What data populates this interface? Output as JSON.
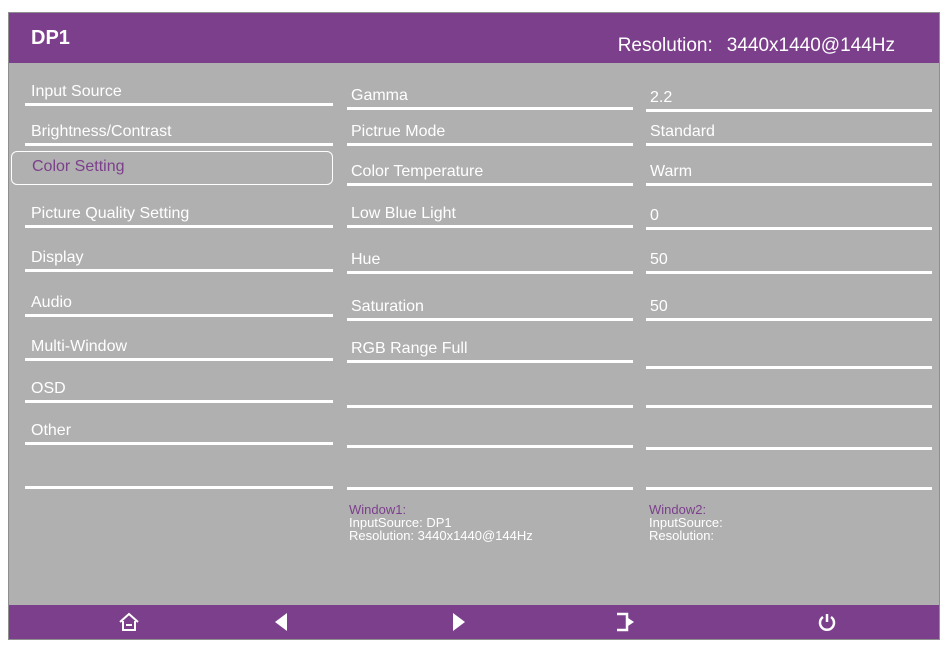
{
  "header": {
    "source": "DP1",
    "resolution_label": "Resolution:",
    "resolution_value": "3440x1440@144Hz"
  },
  "menu": {
    "items": [
      {
        "label": "Input Source"
      },
      {
        "label": "Brightness/Contrast"
      },
      {
        "label": "Color Setting",
        "selected": true
      },
      {
        "label": "Picture Quality Setting"
      },
      {
        "label": "Display"
      },
      {
        "label": "Audio"
      },
      {
        "label": "Multi-Window"
      },
      {
        "label": "OSD"
      },
      {
        "label": "Other"
      },
      {
        "label": ""
      }
    ]
  },
  "settings": {
    "names": [
      "Gamma",
      "Pictrue Mode",
      "Color Temperature",
      "Low Blue Light",
      "Hue",
      "Saturation",
      "RGB Range Full",
      "",
      "",
      ""
    ],
    "values": [
      "2.2",
      "Standard",
      "Warm",
      "0",
      "50",
      "50",
      "",
      "",
      "",
      ""
    ]
  },
  "window1": {
    "title": "Window1:",
    "input": "InputSource:  DP1",
    "resolution": "Resolution:  3440x1440@144Hz"
  },
  "window2": {
    "title": "Window2:",
    "input": "InputSource:",
    "resolution": "Resolution:"
  },
  "footer": {
    "icons": [
      "home-icon",
      "left-arrow-icon",
      "right-arrow-icon",
      "exit-icon",
      "power-icon"
    ]
  },
  "colors": {
    "accent": "#7c3f8c",
    "background": "#b1b0b0",
    "text": "#ffffff"
  }
}
